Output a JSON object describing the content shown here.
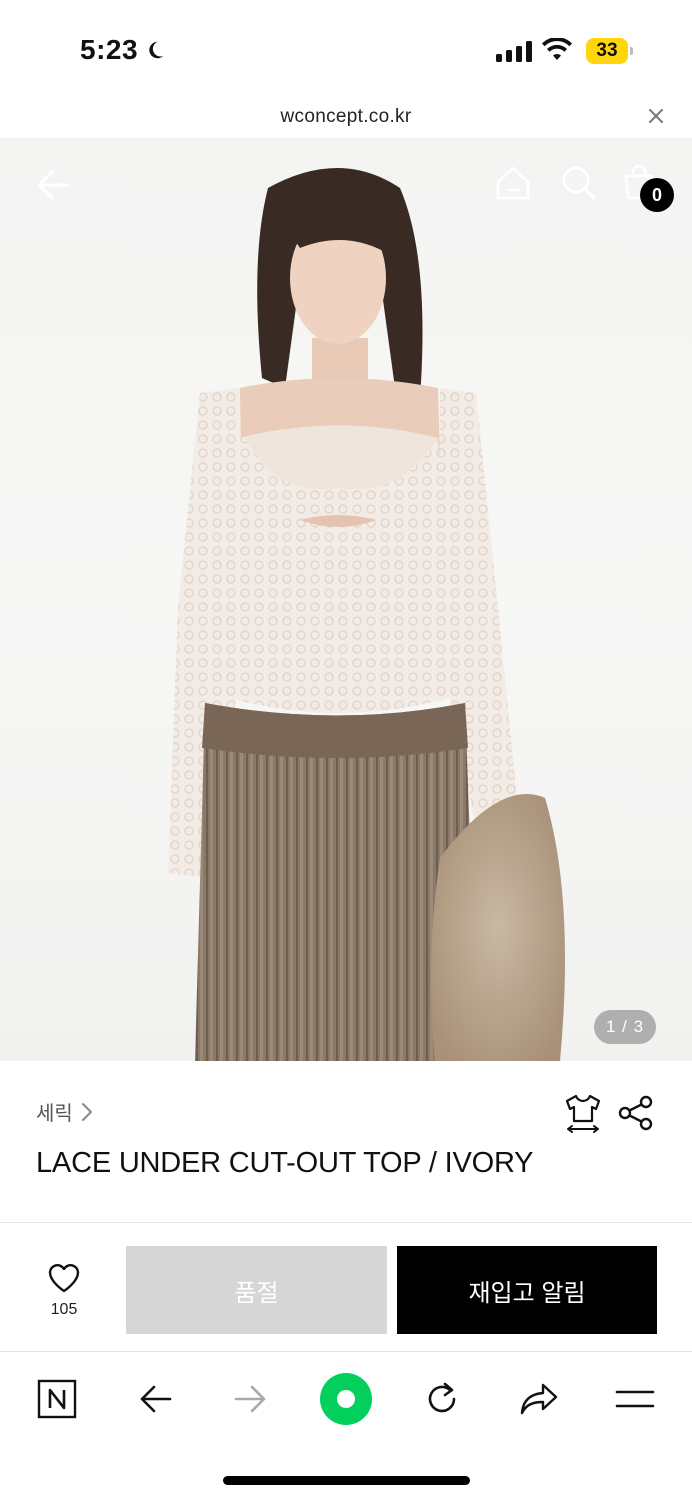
{
  "status_bar": {
    "time": "5:23",
    "battery_level": "33",
    "icons": [
      "moon-icon",
      "cellular-signal-icon",
      "wifi-icon",
      "battery-icon"
    ]
  },
  "browser": {
    "url": "wconcept.co.kr"
  },
  "hero": {
    "cart_count": "0",
    "page_indicator": "1 / 3",
    "image_subject": "model wearing ivory lace cut-out top and brown skirt, holding faux fur jacket",
    "icons": [
      "back-arrow-icon",
      "home-icon",
      "search-icon",
      "cart-icon"
    ]
  },
  "product": {
    "brand": "세릭",
    "title": "LACE UNDER CUT-OUT TOP / IVORY",
    "icons": [
      "size-guide-icon",
      "share-icon"
    ]
  },
  "actions": {
    "like_count": "105",
    "soldout_label": "품절",
    "restock_label": "재입고 알림"
  },
  "toolbar": {
    "icons": [
      "naver-n-icon",
      "back-icon",
      "forward-icon",
      "green-dot-icon",
      "reload-icon",
      "share-arrow-icon",
      "menu-icon"
    ],
    "accent": "#03cf5d"
  }
}
